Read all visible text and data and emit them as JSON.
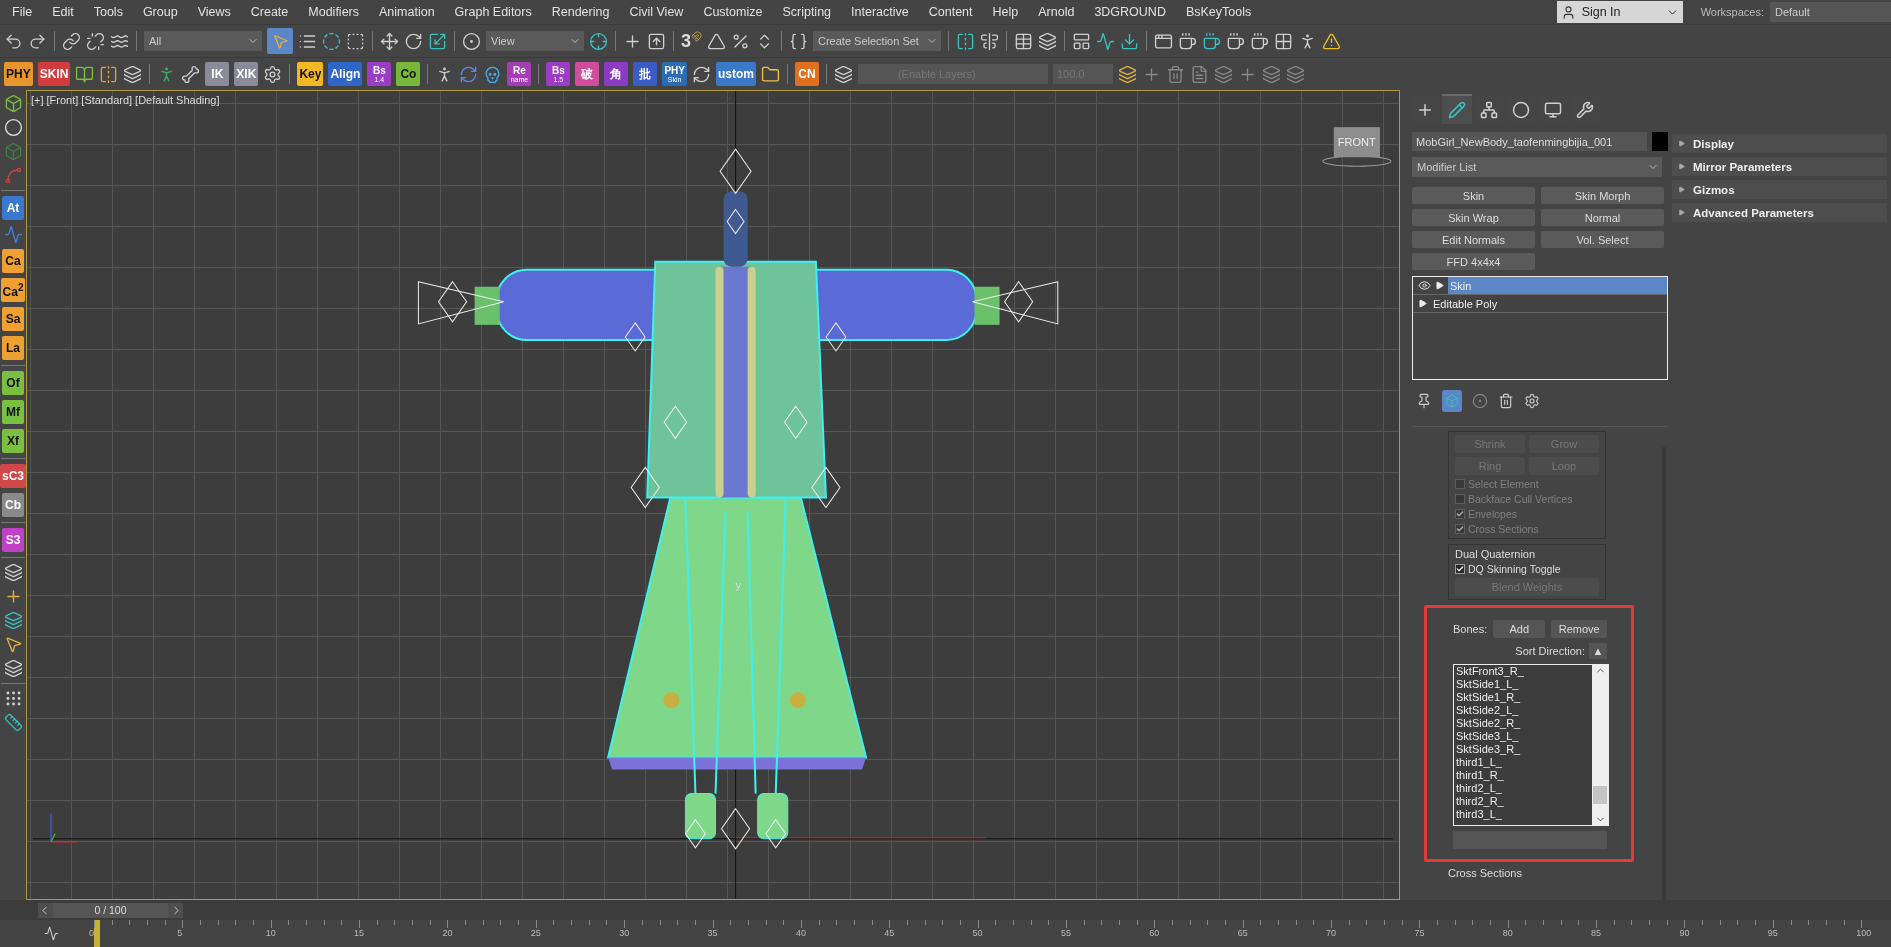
{
  "menu": [
    "File",
    "Edit",
    "Tools",
    "Group",
    "Views",
    "Create",
    "Modifiers",
    "Animation",
    "Graph Editors",
    "Rendering",
    "Civil View",
    "Customize",
    "Scripting",
    "Interactive",
    "Content",
    "Help",
    "Arnold",
    "3DGROUND",
    "BsKeyTools"
  ],
  "account": {
    "sign_in": "Sign In",
    "workspaces_label": "Workspaces:",
    "workspace": "Default"
  },
  "main_toolbar": {
    "filter": "All",
    "select_active": true,
    "coordinate": "View",
    "snap": "3",
    "selection_set": "Create Selection Set"
  },
  "plugin_buttons": [
    {
      "text": "PHY",
      "color": "#e8962c"
    },
    {
      "text": "SKIN",
      "color": "#d23c3c"
    },
    {
      "text": "IK",
      "color": "#8a8a9a"
    },
    {
      "text": "XIK",
      "color": "#8a8a9a"
    },
    {
      "text": "Key",
      "color": "#f2b824"
    },
    {
      "text": "Align",
      "color": "#2f66c8"
    },
    {
      "text": "Bs",
      "sub": "1.4",
      "color": "#9b3cc4"
    },
    {
      "text": "Co",
      "color": "#78b83a"
    },
    {
      "text": "Re",
      "sub": "name",
      "color": "#a43cb4"
    },
    {
      "text": "Bs",
      "sub": "1.5",
      "color": "#9b3cc4"
    },
    {
      "text": "破",
      "color": "#d24c9c"
    },
    {
      "text": "角",
      "color": "#8a3cc4"
    },
    {
      "text": "批",
      "color": "#3a5cc4"
    },
    {
      "text": "PHY",
      "sub": "Skin",
      "color": "#2c6cb4"
    },
    {
      "text": "ustom",
      "color": "#3a78c8"
    },
    {
      "text": "CN",
      "color": "#e0701e"
    }
  ],
  "layer_bar": {
    "layer": "(Enable Layers)",
    "weight": "100.0"
  },
  "side_buttons": [
    {
      "text": "At",
      "color": "#3a78d0"
    },
    {
      "text": "Ca",
      "color": "#f0a030"
    },
    {
      "text": "Ca$^{2}$",
      "color": "#f0a030"
    },
    {
      "text": "Sa",
      "color": "#f0a030"
    },
    {
      "text": "La",
      "color": "#f0a030"
    },
    {
      "text": "Of",
      "color": "#7ac040"
    },
    {
      "text": "Mf",
      "color": "#7ac040"
    },
    {
      "text": "Xf",
      "color": "#7ac040"
    },
    {
      "text": "sC3",
      "color": "#d04848"
    },
    {
      "text": "Cb",
      "color": "#8a8a8a"
    },
    {
      "text": "S3",
      "color": "#c040c8"
    }
  ],
  "viewport": {
    "labels": [
      "[+]",
      "[Front]",
      "[Standard]",
      "[Default Shading]"
    ],
    "view_cube": "FRONT",
    "pivot_label": "y"
  },
  "command_panel": {
    "tabs": [
      {
        "selected": false
      },
      {
        "selected": true
      },
      {
        "selected": false
      },
      {
        "selected": false
      },
      {
        "selected": false
      },
      {
        "selected": false
      }
    ],
    "object_name": "MobGirl_NewBody_taofenmingbijia_001",
    "modifier_list": "Modifier List",
    "modifier_buttons": [
      "Skin",
      "Skin Morph",
      "Skin Wrap",
      "Normal",
      "Edit Normals",
      "Vol. Select",
      "FFD 4x4x4"
    ],
    "stack": [
      {
        "label": "Skin",
        "selected": true
      },
      {
        "label": "Editable Poly",
        "selected": false
      }
    ],
    "rollouts": [
      {
        "title": "Display",
        "expanded": false
      },
      {
        "title": "Mirror Parameters",
        "expanded": false
      },
      {
        "title": "Gizmos",
        "expanded": false
      },
      {
        "title": "Advanced Parameters",
        "expanded": false
      }
    ],
    "select_buttons": [
      "Shrink",
      "Grow",
      "Ring",
      "Loop"
    ],
    "select_options": [
      {
        "label": "Select Element",
        "checked": false,
        "disabled": true
      },
      {
        "label": "Backface Cull Vertices",
        "checked": false,
        "disabled": true
      },
      {
        "label": "Envelopes",
        "checked": true,
        "disabled": true
      },
      {
        "label": "Cross Sections",
        "checked": true,
        "disabled": true
      }
    ],
    "dual_quaternion": {
      "title": "Dual Quaternion",
      "toggle": {
        "label": "DQ Skinning Toggle",
        "checked": true,
        "disabled": false
      },
      "blend": "Blend Weights",
      "blend_disabled": true
    },
    "bones": {
      "label": "Bones:",
      "add": "Add",
      "remove": "Remove",
      "sort_label": "Sort Direction:",
      "sort": "▲",
      "items": [
        "SktFront3_R_",
        "SktSide1_L_",
        "SktSide1_R_",
        "SktSide2_L_",
        "SktSide2_R_",
        "SktSide3_L_",
        "SktSide3_R_",
        "third1_L_",
        "third1_R_",
        "third2_L_",
        "third2_R_",
        "third3_L_"
      ]
    },
    "next_group": "Cross Sections"
  },
  "timeline": {
    "frame": "0 / 100",
    "level": 0,
    "ticks": [
      "0",
      "5",
      "10",
      "15",
      "20",
      "25",
      "30",
      "35",
      "40",
      "45",
      "50",
      "55",
      "60",
      "65",
      "70",
      "75",
      "80",
      "85",
      "90",
      "95",
      "100"
    ]
  }
}
